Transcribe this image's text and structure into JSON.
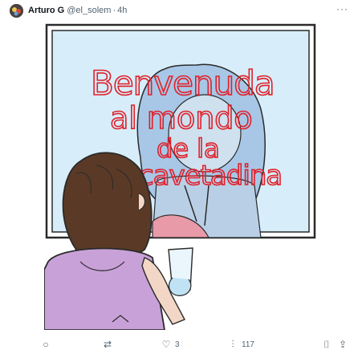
{
  "post": {
    "author_name": "Arturo G",
    "author_handle": "@el_solem",
    "separator": "·",
    "timestamp": "4h",
    "more_icon": "ellipsis-icon",
    "more_label": "···"
  },
  "artwork": {
    "lettering_lines": [
      "Benvenuda",
      "al mondo",
      "de la",
      "cavetadina"
    ],
    "colors": {
      "mirror_bg": "#d7eefa",
      "frame": "#2a2a2a",
      "lettering": "#e0202a",
      "hair": "#5a3a26",
      "shirt": "#c9a1d9",
      "reflection_hair": "#a8c7e6"
    }
  },
  "actions": {
    "reply_icon": "reply-icon",
    "reply_glyph": "○",
    "reply_count": "",
    "repost_icon": "repost-icon",
    "repost_glyph": "⇄",
    "repost_count": "",
    "like_icon": "heart-icon",
    "like_glyph": "♡",
    "like_count": "3",
    "views_icon": "views-icon",
    "views_glyph": "⫶",
    "views_count": "117",
    "bookmark_icon": "bookmark-icon",
    "bookmark_glyph": "⌷",
    "share_icon": "share-icon",
    "share_glyph": "⇪"
  }
}
